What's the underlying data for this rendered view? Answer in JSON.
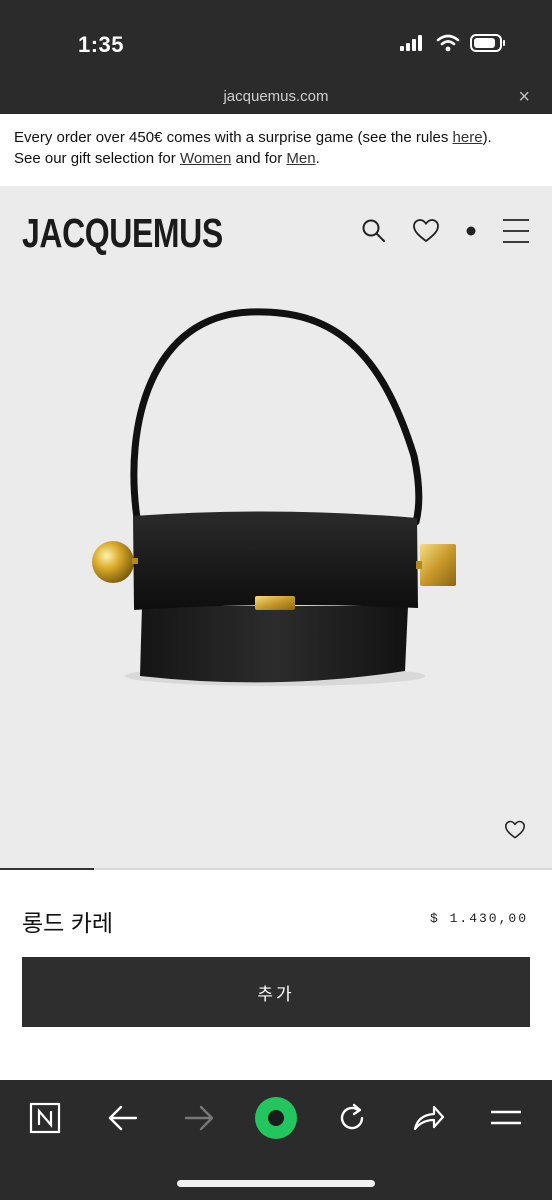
{
  "status_bar": {
    "time": "1:35"
  },
  "browser": {
    "url": "jacquemus.com",
    "close_symbol": "×"
  },
  "banner": {
    "line1_prefix": "Every order over 450€ comes with a surprise game (see the rules ",
    "line1_link": "here",
    "line1_suffix": ").",
    "line2_prefix": "See our gift selection for ",
    "line2_link_women": "Women",
    "line2_mid": " and for ",
    "line2_link_men": "Men",
    "line2_suffix": "."
  },
  "header": {
    "logo": "JACQUEMUS",
    "icons": [
      "search-icon",
      "heart-icon",
      "dot-icon",
      "menu-icon"
    ]
  },
  "gallery": {
    "progress": 0.17
  },
  "product": {
    "name": "롱드 카레",
    "price": "$ 1.430,00",
    "add_button_label": "추가"
  },
  "bottom_nav": {
    "icons": [
      "n-logo-icon",
      "back-arrow-icon",
      "forward-arrow-icon",
      "record-icon",
      "reload-icon",
      "share-icon",
      "menu-icon"
    ],
    "accent_color": "#22c55e"
  }
}
